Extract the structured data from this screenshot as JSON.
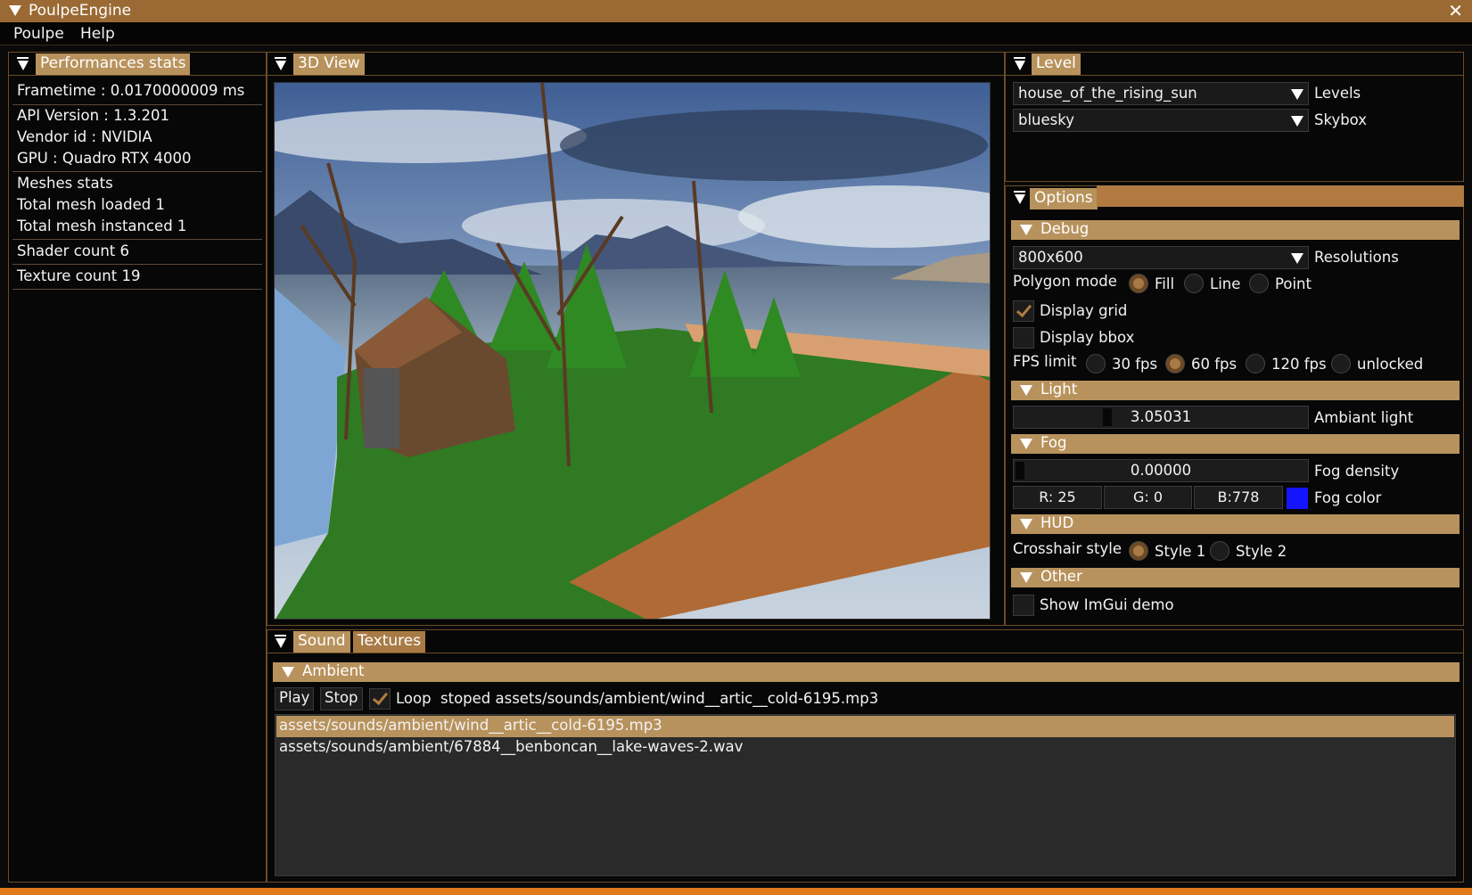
{
  "window": {
    "title": "PoulpeEngine"
  },
  "menu": {
    "items": [
      "Poulpe",
      "Help"
    ]
  },
  "perf": {
    "tab": "Performances stats",
    "frametime": "Frametime : 0.0170000009 ms",
    "api": "API Version : 1.3.201",
    "vendor": "Vendor id : NVIDIA",
    "gpu": "GPU : Quadro RTX 4000",
    "meshes_title": "Meshes stats",
    "mesh_loaded": "Total mesh loaded 1",
    "mesh_instanced": "Total mesh instanced 1",
    "shader_count": "Shader count 6",
    "texture_count": "Texture count 19"
  },
  "view3d": {
    "tab": "3D View"
  },
  "level": {
    "tab": "Level",
    "level_value": "house_of_the_rising_sun",
    "level_label": "Levels",
    "skybox_value": "bluesky",
    "skybox_label": "Skybox"
  },
  "options": {
    "tab": "Options",
    "debug": {
      "header": "Debug",
      "resolution_value": "800x600",
      "resolution_label": "Resolutions",
      "polygon_label": "Polygon mode",
      "polygon_options": [
        "Fill",
        "Line",
        "Point"
      ],
      "polygon_selected": "Fill",
      "display_grid": "Display grid",
      "display_grid_checked": true,
      "display_bbox": "Display bbox",
      "display_bbox_checked": false,
      "fps_label": "FPS limit",
      "fps_options": [
        "30 fps",
        "60 fps",
        "120 fps",
        "unlocked"
      ],
      "fps_selected": "60 fps"
    },
    "light": {
      "header": "Light",
      "ambient_value": "3.05031",
      "ambient_label": "Ambiant light"
    },
    "fog": {
      "header": "Fog",
      "density_value": "0.00000",
      "density_label": "Fog density",
      "r": "R: 25",
      "g": "G:  0",
      "b": "B:778",
      "color_label": "Fog color",
      "swatch_color": "#1414ff"
    },
    "hud": {
      "header": "HUD",
      "crosshair_label": "Crosshair style",
      "styles": [
        "Style 1",
        "Style 2"
      ],
      "style_selected": "Style 1"
    },
    "other": {
      "header": "Other",
      "imgui_demo": "Show ImGui demo",
      "imgui_demo_checked": false
    }
  },
  "bottom": {
    "tabs": [
      "Sound",
      "Textures"
    ],
    "ambient_header": "Ambient",
    "play": "Play",
    "stop": "Stop",
    "loop": "Loop",
    "loop_checked": true,
    "status": "stoped assets/sounds/ambient/wind__artic__cold-6195.mp3",
    "files": [
      "assets/sounds/ambient/wind__artic__cold-6195.mp3",
      "assets/sounds/ambient/67884__benboncan__lake-waves-2.wav"
    ],
    "selected_index": 0
  },
  "colors": {
    "accent": "#b8925c",
    "titlebar": "#9b6a34",
    "border": "#6b4b27"
  }
}
